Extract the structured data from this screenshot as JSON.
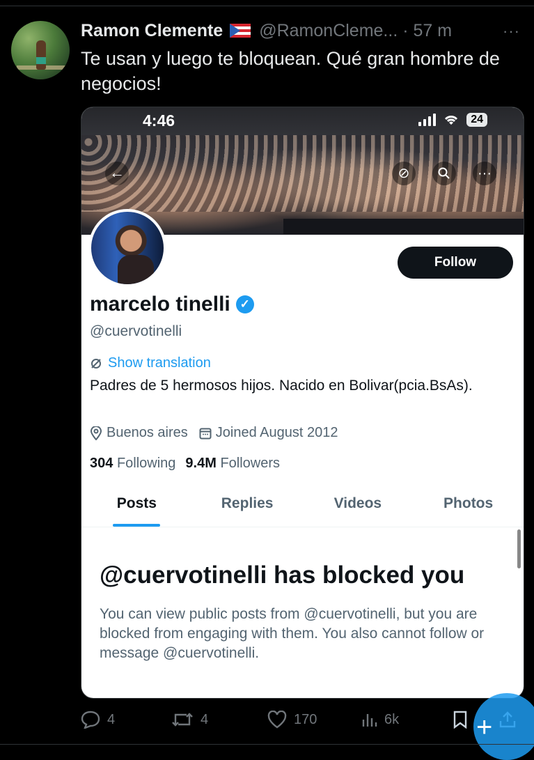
{
  "tweet": {
    "author_name": "Ramon Clemente",
    "author_flag": "🇵🇷",
    "handle_and_time": "@RamonCleme... · 57 m",
    "more": "···",
    "text": "Te usan y luego te bloquean. Qué gran hombre de negocios!"
  },
  "screenshot": {
    "status_time": "4:46",
    "battery": "24",
    "profile": {
      "follow_label": "Follow",
      "name": "marcelo tinelli",
      "verified": "✓",
      "handle": "@cuervotinelli",
      "translate_label": "Show translation",
      "bio": "Padres de 5 hermosos hijos. Nacido en Bolivar(pcia.BsAs).",
      "location": "Buenos aires",
      "joined": "Joined August 2012",
      "following_count": "304",
      "following_label": "Following",
      "followers_count": "9.4M",
      "followers_label": "Followers"
    },
    "tabs": [
      {
        "label": "Posts",
        "active": true
      },
      {
        "label": "Replies",
        "active": false
      },
      {
        "label": "Videos",
        "active": false
      },
      {
        "label": "Photos",
        "active": false
      }
    ],
    "blocked": {
      "title": "@cuervotinelli has blocked you",
      "description": "You can view public posts from @cuervotinelli, but you are blocked from engaging with them. You also cannot follow or message @cuervotinelli."
    }
  },
  "actions": {
    "replies": "4",
    "reposts": "4",
    "likes": "170",
    "views": "6k"
  },
  "colors": {
    "background": "#000000",
    "accent": "#1d9bf0",
    "muted": "#71767b"
  },
  "icons": [
    "reply-icon",
    "repost-icon",
    "like-icon",
    "views-icon",
    "bookmark-icon",
    "share-icon",
    "back-arrow-icon",
    "search-icon",
    "more-icon",
    "location-icon",
    "calendar-icon",
    "translate-icon",
    "verified-icon",
    "compose-icon"
  ]
}
